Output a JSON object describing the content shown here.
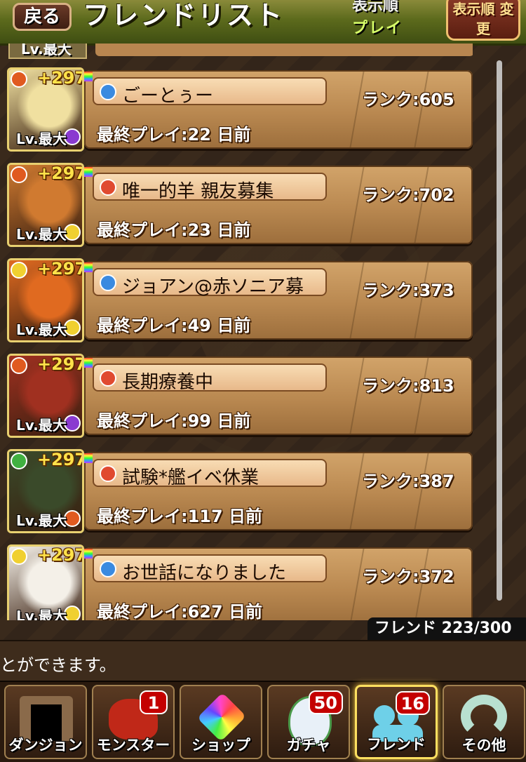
{
  "header": {
    "back_label": "戻る",
    "title": "フレンドリスト",
    "sort_label": "表示順",
    "sort_value": "プレイ",
    "sort_change_label": "表示順 変更",
    "top_partial_level": "Lv.最大"
  },
  "friends": [
    {
      "bonus": "+297",
      "level": "Lv.最大",
      "name": "ごーとぅー",
      "rank": "ランク:605",
      "last_play": "最終プレイ:22 日前",
      "attr_main": "#e05a20",
      "attr_sub": "#8a3ad0",
      "name_orb": "#3a8ae0",
      "art": "#f0e0a0"
    },
    {
      "bonus": "+297",
      "level": "Lv.最大",
      "name": "唯一的羊 親友募集",
      "rank": "ランク:702",
      "last_play": "最終プレイ:23 日前",
      "attr_main": "#e05a20",
      "attr_sub": "#f0d030",
      "name_orb": "#e04a30",
      "art": "#d07a30"
    },
    {
      "bonus": "+297",
      "level": "Lv.最大",
      "name": "ジョアン@赤ソニア募",
      "rank": "ランク:373",
      "last_play": "最終プレイ:49 日前",
      "attr_main": "#f0d030",
      "attr_sub": "#f0d030",
      "name_orb": "#3a8ae0",
      "art": "#e06a20"
    },
    {
      "bonus": "+297",
      "level": "Lv.最大",
      "name": "長期療養中",
      "rank": "ランク:813",
      "last_play": "最終プレイ:99 日前",
      "attr_main": "#e05a20",
      "attr_sub": "#8a3ad0",
      "name_orb": "#e04a30",
      "art": "#a03020"
    },
    {
      "bonus": "+297",
      "level": "Lv.最大",
      "name": "試験*艦イベ休業",
      "rank": "ランク:387",
      "last_play": "最終プレイ:117 日前",
      "attr_main": "#40b040",
      "attr_sub": "#e05a20",
      "name_orb": "#e04a30",
      "art": "#3a4a2a"
    },
    {
      "bonus": "+297",
      "level": "Lv.最大",
      "name": "お世話になりました",
      "rank": "ランク:372",
      "last_play": "最終プレイ:627 日前",
      "attr_main": "#f0d030",
      "attr_sub": "#f0d030",
      "name_orb": "#3a8ae0",
      "art": "#f4f0e8"
    }
  ],
  "friend_count": "フレンド 223/300",
  "message": "とができます。",
  "nav": [
    {
      "label": "ダンジョン",
      "count": "",
      "icon": "dungeon-gate-icon"
    },
    {
      "label": "モンスター",
      "count": "1",
      "icon": "dragon-icon"
    },
    {
      "label": "ショップ",
      "count": "",
      "icon": "rainbow-gem-icon"
    },
    {
      "label": "ガチャ",
      "count": "50",
      "icon": "egg-icon"
    },
    {
      "label": "フレンド",
      "count": "16",
      "icon": "friends-icon"
    },
    {
      "label": "その他",
      "count": "",
      "icon": "question-icon"
    }
  ]
}
